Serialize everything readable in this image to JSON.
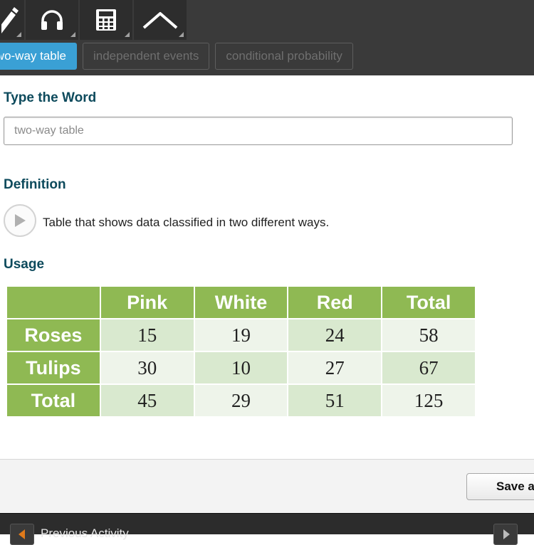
{
  "toolbar": {
    "tools": [
      {
        "icon": "pencil-icon"
      },
      {
        "icon": "headphones-icon"
      },
      {
        "icon": "calculator-icon"
      },
      {
        "icon": "caret-up-icon"
      }
    ]
  },
  "tags": [
    {
      "label": "two-way table",
      "active": true
    },
    {
      "label": "independent events",
      "active": false
    },
    {
      "label": "conditional probability",
      "active": false
    }
  ],
  "type_word": {
    "heading": "Type the Word",
    "placeholder": "two-way table"
  },
  "definition": {
    "heading": "Definition",
    "text": "Table that shows data classified in two different ways.",
    "play_icon": "play-icon"
  },
  "usage": {
    "heading": "Usage",
    "table": {
      "header": [
        "",
        "Pink",
        "White",
        "Red",
        "Total"
      ],
      "rows": [
        [
          "Roses",
          "15",
          "19",
          "24",
          "58"
        ],
        [
          "Tulips",
          "30",
          "10",
          "27",
          "67"
        ],
        [
          "Total",
          "45",
          "29",
          "51",
          "125"
        ]
      ]
    }
  },
  "footer": {
    "save_label": "Save a",
    "prev_label": "Previous Activity"
  },
  "colors": {
    "accent": "#3aa0d5",
    "heading": "#0d4a5c",
    "table_header": "#8fb953"
  }
}
